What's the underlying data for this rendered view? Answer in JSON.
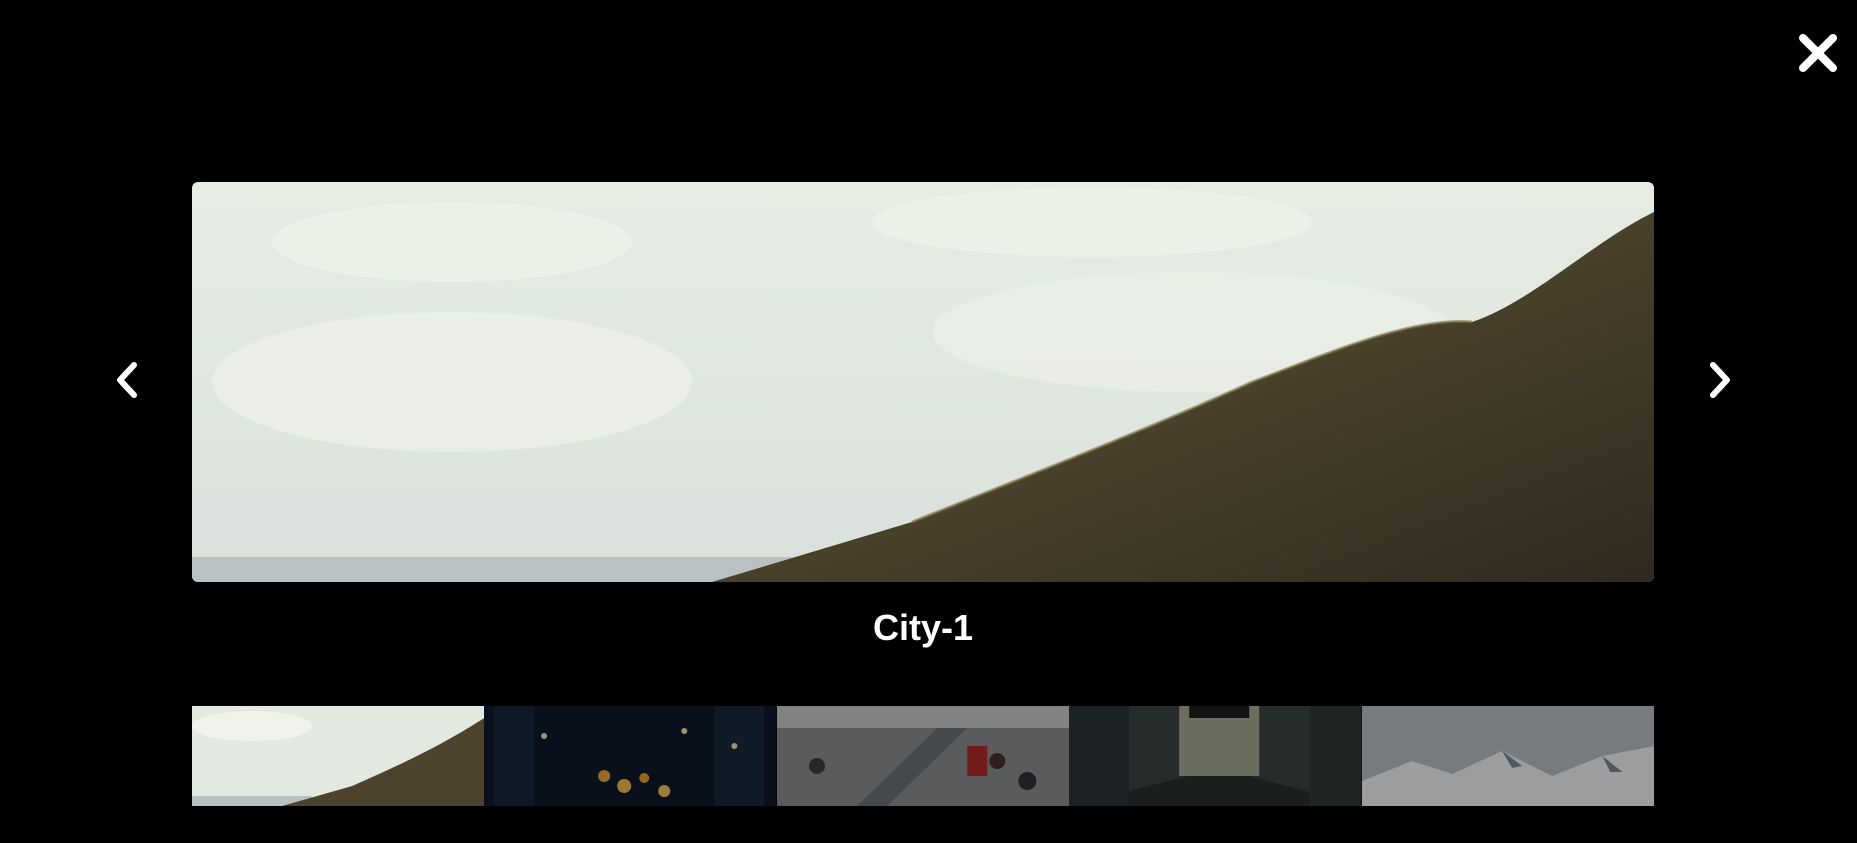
{
  "lightbox": {
    "caption": "City-1",
    "current_index": 0,
    "controls": {
      "close_icon": "close-icon",
      "prev_icon": "chevron-left-icon",
      "next_icon": "chevron-right-icon"
    },
    "thumbnails": [
      {
        "label": "City-1",
        "subject": "hillside-landscape",
        "active": true
      },
      {
        "label": "",
        "subject": "night-city-traffic",
        "active": false
      },
      {
        "label": "",
        "subject": "crowded-escalators",
        "active": false
      },
      {
        "label": "",
        "subject": "city-underpass",
        "active": false
      },
      {
        "label": "",
        "subject": "snowy-mountains",
        "active": false
      }
    ]
  },
  "colors": {
    "background": "#000000",
    "foreground": "#ffffff"
  }
}
